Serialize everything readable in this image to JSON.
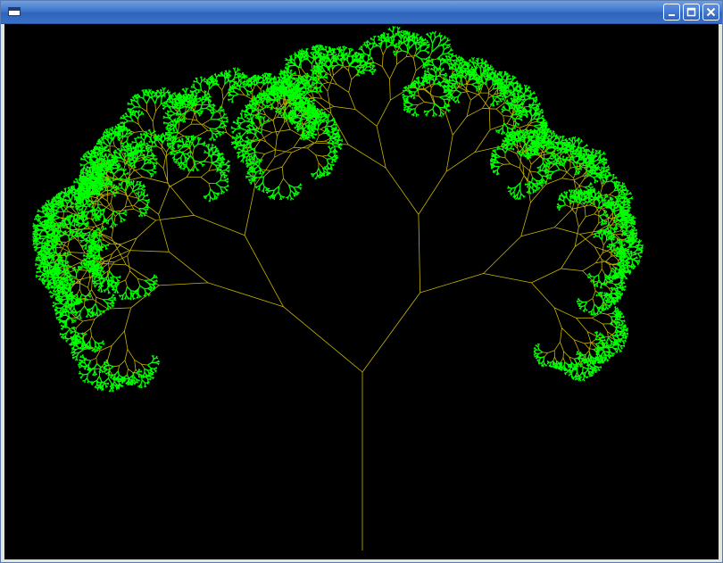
{
  "window": {
    "title": "",
    "icon": "app-window-icon",
    "controls": {
      "minimize_icon": "minimize-icon",
      "maximize_icon": "maximize-icon",
      "close_icon": "close-icon"
    }
  },
  "canvas": {
    "background": "#000000",
    "branch_color": "#c8b400",
    "leaf_color": "#00ff00",
    "content": "fractal-tree"
  }
}
